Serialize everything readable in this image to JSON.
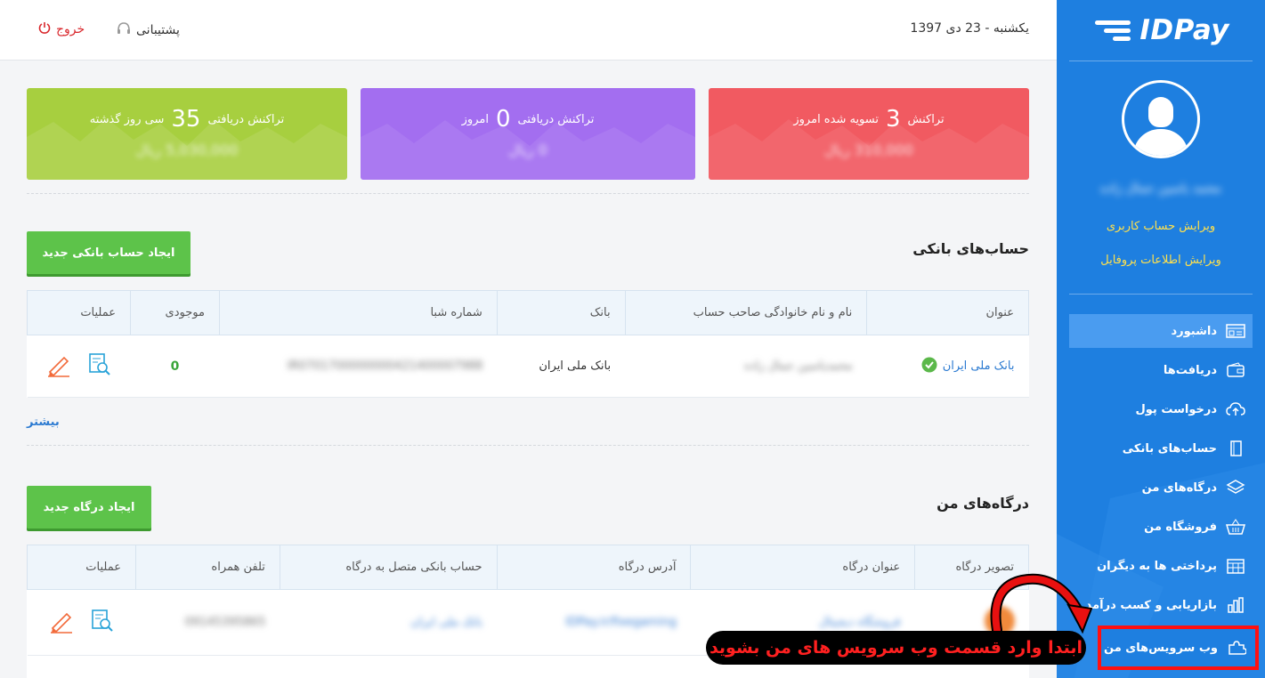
{
  "topbar": {
    "date": "یکشنبه - 23 دی 1397",
    "support_label": "پشتیبانی",
    "logout_label": "خروج"
  },
  "sidebar": {
    "logo_text": "IDPay",
    "username": "محمد یاسین جمال زاده",
    "edit_account": "ویرایش حساب کاربری",
    "edit_profile": "ویرایش اطلاعات پروفایل",
    "items": [
      {
        "label": "داشبورد",
        "icon": "dashboard-icon"
      },
      {
        "label": "دریافت‌ها",
        "icon": "wallet-icon"
      },
      {
        "label": "درخواست پول",
        "icon": "cloud-upload-icon"
      },
      {
        "label": "حساب‌های بانکی",
        "icon": "book-icon"
      },
      {
        "label": "درگاه‌های من",
        "icon": "layers-icon"
      },
      {
        "label": "فروشگاه من",
        "icon": "basket-icon"
      },
      {
        "label": "پرداختی ها به دیگران",
        "icon": "calendar-grid-icon"
      },
      {
        "label": "بازاریابی و کسب درآمد",
        "icon": "bar-chart-icon"
      },
      {
        "label": "وب سرویس‌های من",
        "icon": "puzzle-icon"
      }
    ]
  },
  "cards": {
    "settled": {
      "prefix": "تسویه شده امروز",
      "count": "3",
      "suffix": "تراکنش",
      "amount": "310,000 ریال"
    },
    "today": {
      "prefix": "امروز",
      "count": "0",
      "suffix": "تراکنش دریافتی",
      "amount": "0 ریال"
    },
    "month": {
      "prefix": "سی روز گذشته",
      "count": "35",
      "suffix": "تراکنش دریافتی",
      "amount": "5,030,000 ریال"
    }
  },
  "bank_accounts": {
    "title": "حساب‌های بانکی",
    "create_button": "ایجاد حساب بانکی جدید",
    "headers": [
      "عنوان",
      "نام و نام خانوادگی صاحب حساب",
      "بانک",
      "شماره شبا",
      "موجودی",
      "عملیات"
    ],
    "rows": [
      {
        "title": "بانک ملی ایران",
        "owner": "محمدیاسین جمال زاده",
        "bank": "بانک ملی ایران",
        "iban": "IR0701700000000421400007988",
        "balance": "0"
      }
    ],
    "more_link": "بیشتر"
  },
  "gateways": {
    "title": "درگاه‌های من",
    "create_button": "ایجاد درگاه جدید",
    "headers": [
      "تصویر درگاه",
      "عنوان درگاه",
      "آدرس درگاه",
      "حساب بانکی متصل به درگاه",
      "تلفن همراه",
      "عملیات"
    ],
    "rows": [
      {
        "name": "فروشگاه دیجیتال",
        "url": "IDPay.ir/fixegaming",
        "account": "بانک ملی ایران",
        "phone": "09145395865"
      }
    ]
  },
  "annotation": {
    "callout_text": "ابتدا وارد قسمت وب سرویس های من بشوید"
  },
  "colors": {
    "sidebar": "#1e7fe0",
    "card_red": "#f15a61",
    "card_purple": "#a36ef0",
    "card_green": "#a7cf3f",
    "button_green": "#5dc34a",
    "callout_red": "#ff2020"
  }
}
